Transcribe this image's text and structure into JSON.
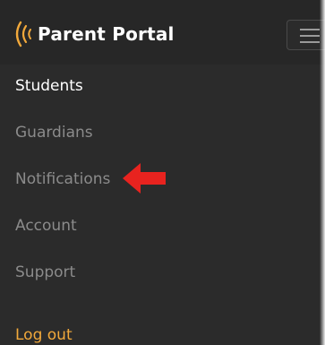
{
  "header": {
    "brand_name": "Parent Portal",
    "logo_icon": "radio-waves-logo",
    "menu_icon": "hamburger-menu-icon"
  },
  "nav": {
    "items": [
      {
        "label": "Students",
        "state": "active"
      },
      {
        "label": "Guardians",
        "state": "inactive"
      },
      {
        "label": "Notifications",
        "state": "inactive"
      },
      {
        "label": "Account",
        "state": "inactive"
      },
      {
        "label": "Support",
        "state": "inactive"
      }
    ],
    "logout_label": "Log out"
  },
  "annotation": {
    "icon": "red-arrow-pointer",
    "points_to": "Notifications"
  },
  "colors": {
    "background": "#2b2b2b",
    "active_text": "#ffffff",
    "inactive_text": "#8b8b8b",
    "accent": "#f2a93b",
    "annotation_arrow": "#e8231f"
  }
}
